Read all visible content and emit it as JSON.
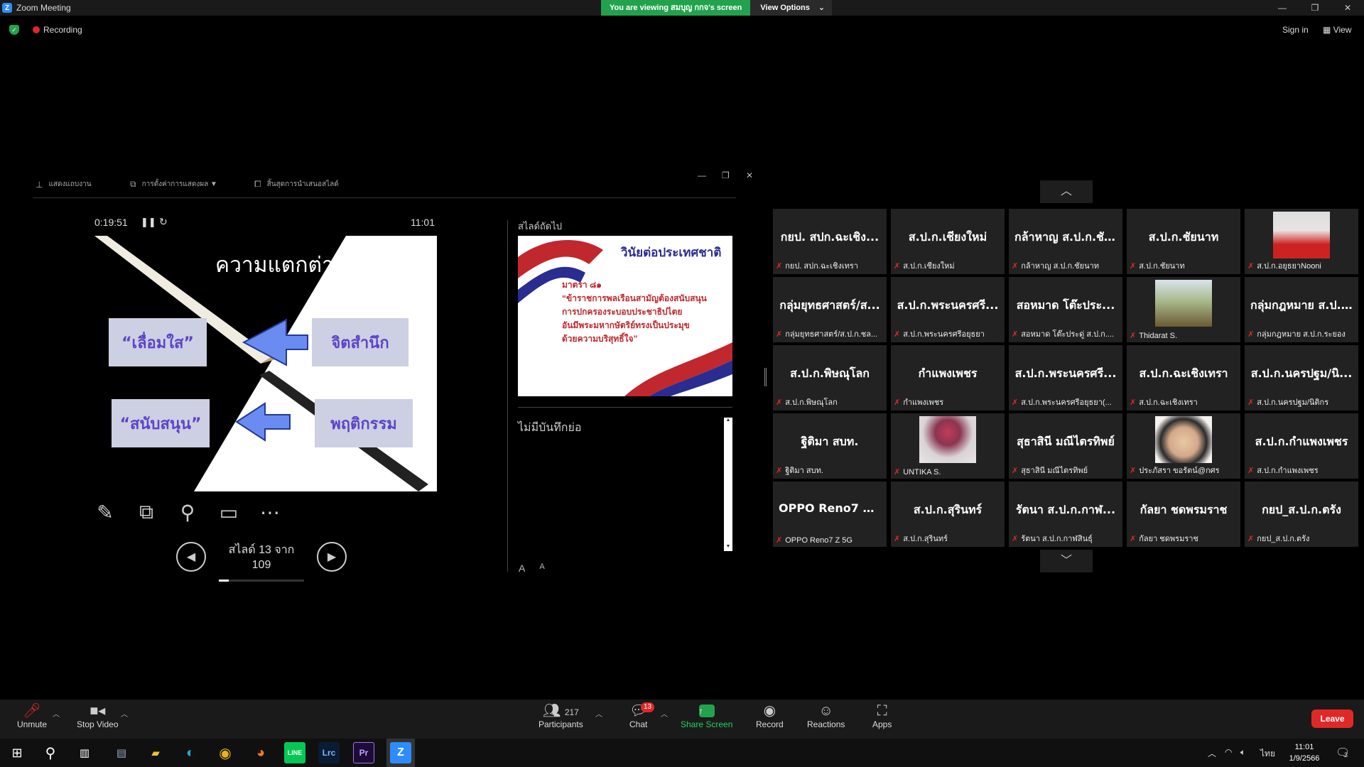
{
  "window": {
    "title": "Zoom Meeting",
    "viewing_banner": "You are viewing สมบุญ กกจ's screen",
    "view_options": "View Options",
    "view_options_caret": "⌄"
  },
  "status": {
    "recording": "Recording",
    "sign_in": "Sign in",
    "view": "View"
  },
  "presenter": {
    "toolbar": [
      "แสดงแถบงาน",
      "การตั้งค่าการแสดงผล ▼",
      "สิ้นสุดการนำเสนอสไลด์"
    ],
    "timer": "0:19:51",
    "clock": "11:01",
    "slide": {
      "title": "ความแตกต่าง",
      "boxes": [
        "“เลื่อมใส”",
        "จิตสำนึก",
        "“สนับสนุน”",
        "พฤติกรรม"
      ]
    },
    "slide_counter": "สไลด์ 13 จาก 109",
    "slide_progress": 0.12,
    "next_label": "สไลด์ถัดไป",
    "next_slide": {
      "title": "วินัยต่อประเทศชาติ",
      "lines": [
        "มาตรา ๘๑",
        "“ข้าราชการพลเรือนสามัญต้องสนับสนุน",
        "การปกครองระบอบประชาธิปไตย",
        "อันมีพระมหากษัตริย์ทรงเป็นประมุข",
        "ด้วยความบริสุทธิ์ใจ”"
      ]
    },
    "notes": "ไม่มีบันทึกย่อ"
  },
  "gallery": {
    "tiles": [
      {
        "big": "กยป. สปก.ฉะเชิง...",
        "name": "กยป. สปก.ฉะเชิงเทรา",
        "photo": null
      },
      {
        "big": "ส.ป.ก.เชียงใหม่",
        "name": "ส.ป.ก.เชียงใหม่",
        "photo": null
      },
      {
        "big": "กล้าหาญ ส.ป.ก.ชั...",
        "name": "กล้าหาญ ส.ป.ก.ชัยนาท",
        "photo": null
      },
      {
        "big": "ส.ป.ก.ชัยนาท",
        "name": "ส.ป.ก.ชัยนาท",
        "photo": null
      },
      {
        "big": "",
        "name": "ส.ป.ก.อยุธยาNooni",
        "photo": "woman"
      },
      {
        "big": "กลุ่มยุทธศาสตร์/ส...",
        "name": "กลุ่มยุทธศาสตร์/ส.ป.ก.ชล...",
        "photo": null
      },
      {
        "big": "ส.ป.ก.พระนครศรี...",
        "name": "ส.ป.ก.พระนครศรีอยุธยา",
        "photo": null
      },
      {
        "big": "สอหมาด โต๊ะประ...",
        "name": "สอหมาด โต๊ะประดู่ ส.ป.ก....",
        "photo": null
      },
      {
        "big": "",
        "name": "Thidarat S.",
        "photo": "field"
      },
      {
        "big": "กลุ่มกฎหมาย ส.ป....",
        "name": "กลุ่มกฎหมาย ส.ป.ก.ระยอง",
        "photo": null
      },
      {
        "big": "ส.ป.ก.พิษณุโลก",
        "name": "ส.ป.ก.พิษณุโลก",
        "photo": null
      },
      {
        "big": "กำแพงเพชร",
        "name": "กำแพงเพชร",
        "photo": null
      },
      {
        "big": "ส.ป.ก.พระนครศรี...",
        "name": "ส.ป.ก.พระนครศรีอยุธยา(...",
        "photo": null
      },
      {
        "big": "ส.ป.ก.ฉะเชิงเทรา",
        "name": "ส.ป.ก.ฉะเชิงเทรา",
        "photo": null
      },
      {
        "big": "ส.ป.ก.นครปฐม/นิ...",
        "name": "ส.ป.ก.นครปฐม/นิติกร",
        "photo": null
      },
      {
        "big": "ฐิติมา สบท.",
        "name": "ฐิติมา สบท.",
        "photo": null
      },
      {
        "big": "",
        "name": "UNTIKA S.",
        "photo": "rose"
      },
      {
        "big": "สุธาสินี มณีไตรทิพย์",
        "name": "สุธาสินี มณีไตรทิพย์",
        "photo": null
      },
      {
        "big": "",
        "name": "ประภัสรา ขอรัตน์@กศร",
        "photo": "glasses"
      },
      {
        "big": "ส.ป.ก.กำแพงเพชร",
        "name": "ส.ป.ก.กำแพงเพชร",
        "photo": null
      },
      {
        "big": "OPPO Reno7 Z 5G",
        "name": "OPPO Reno7 Z 5G",
        "photo": null
      },
      {
        "big": "ส.ป.ก.สุรินทร์",
        "name": "ส.ป.ก.สุรินทร์",
        "photo": null
      },
      {
        "big": "รัตนา ส.ป.ก.กาฬ...",
        "name": "รัตนา ส.ป.ก.กาฬสินธุ์",
        "photo": null
      },
      {
        "big": "กัลยา ชดพรมราช",
        "name": "กัลยา ชดพรมราช",
        "photo": null
      },
      {
        "big": "กยป_ส.ป.ก.ตรัง",
        "name": "กยป_ส.ป.ก.ตรัง",
        "photo": null
      }
    ]
  },
  "toolbar": {
    "unmute": "Unmute",
    "stop_video": "Stop Video",
    "participants": "Participants",
    "participants_count": "217",
    "chat": "Chat",
    "chat_badge": "13",
    "share_screen": "Share Screen",
    "record": "Record",
    "reactions": "Reactions",
    "apps": "Apps",
    "leave": "Leave"
  },
  "taskbar": {
    "apps": [
      "Start",
      "Search",
      "Task View",
      "Photos",
      "File Explorer",
      "Edge",
      "Chrome",
      "Firefox",
      "LINE",
      "Lrc",
      "Pr",
      "Zoom"
    ],
    "language": "ไทย",
    "time": "11:01",
    "date": "1/9/2566",
    "notif": "3"
  },
  "colors": {
    "zoom_blue": "#2d8cff",
    "green": "#23a24d",
    "leave_red": "#e02828",
    "tile_bg": "#222222"
  }
}
